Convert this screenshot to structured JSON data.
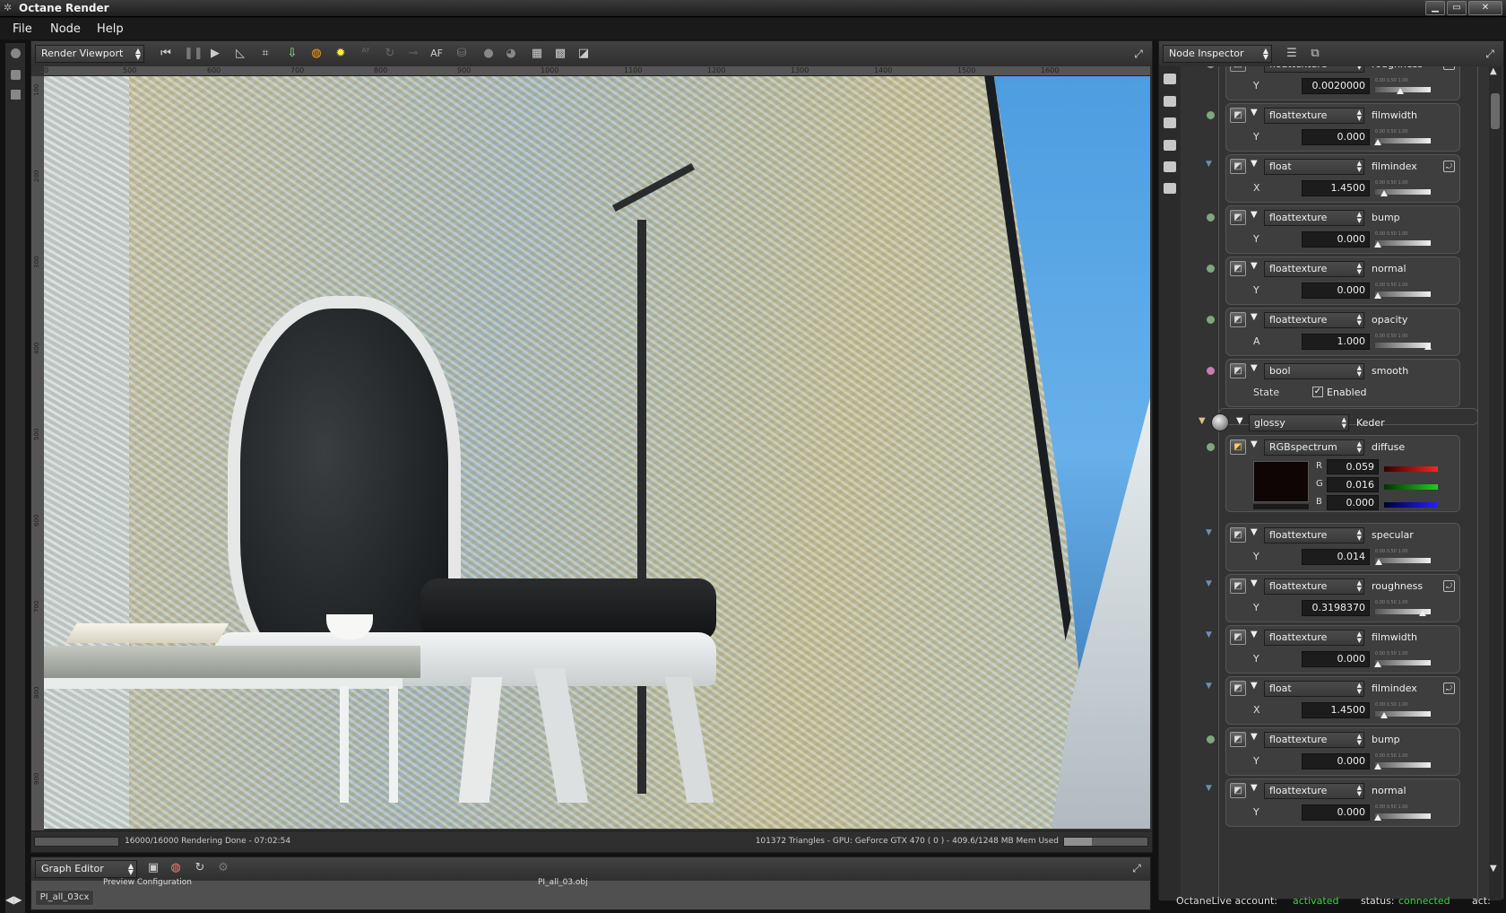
{
  "window": {
    "title": "Octane Render",
    "minimize": "▁",
    "maximize": "▭",
    "close": "✕"
  },
  "menu": [
    "File",
    "Node",
    "Help"
  ],
  "viewport": {
    "selector": "Render Viewport",
    "toolbar_icons": [
      "rewind-icon",
      "pause-icon",
      "play-icon",
      "focus-picker-icon",
      "region-icon",
      "camera-import-icon",
      "material-picker-icon",
      "sun-icon",
      "af-icon",
      "reload-icon",
      "lock-icon",
      "af-label",
      "clay-icon",
      "sphere-icon",
      "sphere2-icon",
      "grid-icon",
      "checker-icon",
      "overlay-icon"
    ],
    "af_label": "AF",
    "ruler_h": [
      "0",
      "500",
      "600",
      "700",
      "800",
      "900",
      "1000",
      "1100",
      "1200",
      "1300",
      "1400",
      "1500",
      "1600"
    ],
    "ruler_v": [
      "100",
      "200",
      "300",
      "400",
      "500",
      "600",
      "700",
      "800",
      "900"
    ],
    "status_left": "16000/16000 Rendering Done - 07:02:54",
    "status_right": "101372 Triangles - GPU: GeForce GTX 470 ( 0 ) - 409.6/1248 MB Mem Used",
    "mem_fraction": 0.33
  },
  "graph_editor": {
    "selector": "Graph Editor",
    "tab": "PI_all_03cx",
    "canvas_text_1": "Preview Configuration",
    "canvas_text_2": "PI_all_03.obj"
  },
  "inspector": {
    "selector": "Node Inspector",
    "nodes_top": [
      {
        "type": "floattexture",
        "param": "roughness",
        "axis": "Y",
        "value": "0.0020000",
        "pinned": true,
        "dot": "#7fa67f",
        "knob": 0.45
      },
      {
        "type": "floattexture",
        "param": "filmwidth",
        "axis": "Y",
        "value": "0.000",
        "pinned": false,
        "dot": "#7fa67f",
        "knob": 0.0
      },
      {
        "type": "float",
        "param": "filmindex",
        "axis": "X",
        "value": "1.4500",
        "pinned": true,
        "dot": "tri",
        "knob": 0.12
      },
      {
        "type": "floattexture",
        "param": "bump",
        "axis": "Y",
        "value": "0.000",
        "pinned": false,
        "dot": "#7fa67f",
        "knob": 0.0
      },
      {
        "type": "floattexture",
        "param": "normal",
        "axis": "Y",
        "value": "0.000",
        "pinned": false,
        "dot": "#7fa67f",
        "knob": 0.0
      },
      {
        "type": "floattexture",
        "param": "opacity",
        "axis": "A",
        "value": "1.000",
        "pinned": false,
        "dot": "#7fa67f",
        "knob": 1.0
      },
      {
        "type": "bool",
        "param": "smooth",
        "axis": "State",
        "value": "Enabled",
        "pinned": false,
        "dot": "#c77fb0"
      }
    ],
    "material": {
      "type": "glossy",
      "name": "Keder"
    },
    "rgb": {
      "type": "RGBspectrum",
      "param": "diffuse",
      "r": "0.059",
      "g": "0.016",
      "b": "0.000",
      "swatch": "#0f0504"
    },
    "nodes_bottom": [
      {
        "type": "floattexture",
        "param": "specular",
        "axis": "Y",
        "value": "0.014",
        "pinned": false,
        "dot": "tri",
        "knob": 0.014
      },
      {
        "type": "floattexture",
        "param": "roughness",
        "axis": "Y",
        "value": "0.3198370",
        "pinned": true,
        "dot": "tri",
        "knob": 0.9
      },
      {
        "type": "floattexture",
        "param": "filmwidth",
        "axis": "Y",
        "value": "0.000",
        "pinned": false,
        "dot": "tri",
        "knob": 0.0
      },
      {
        "type": "float",
        "param": "filmindex",
        "axis": "X",
        "value": "1.4500",
        "pinned": true,
        "dot": "tri",
        "knob": 0.12
      },
      {
        "type": "floattexture",
        "param": "bump",
        "axis": "Y",
        "value": "0.000",
        "pinned": false,
        "dot": "#7fa67f",
        "knob": 0.0
      },
      {
        "type": "floattexture",
        "param": "normal",
        "axis": "Y",
        "value": "0.000",
        "pinned": false,
        "dot": "tri",
        "knob": 0.0
      }
    ]
  },
  "status": {
    "account_label": "OctaneLive account:",
    "account_value": "activated",
    "status_label": "status:",
    "status_value": "connected",
    "act_label": "act:"
  }
}
